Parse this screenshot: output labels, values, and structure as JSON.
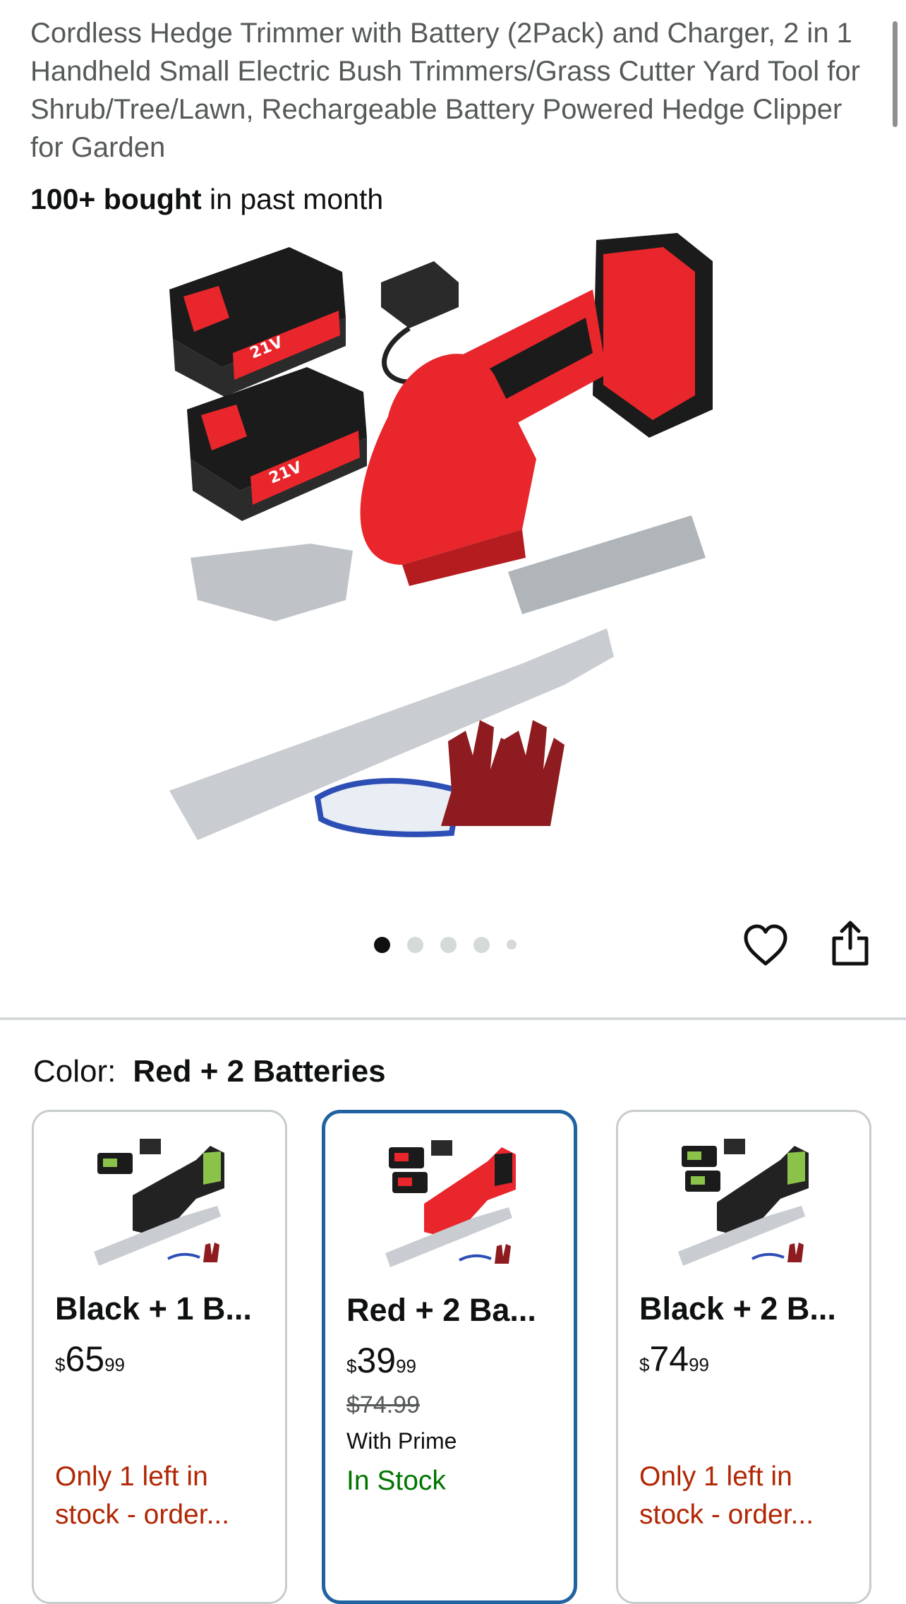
{
  "product": {
    "title": "Cordless Hedge Trimmer with Battery (2Pack) and Charger, 2 in 1 Handheld Small Electric Bush Trimmers/Grass Cutter Yard Tool for Shrub/Tree/Lawn, Rechargeable Battery Powered Hedge Clipper for Garden",
    "bought_bold": "100+ bought",
    "bought_rest": " in past month",
    "image_count": 5,
    "active_image": 1
  },
  "color": {
    "label": "Color:",
    "selected": "Red + 2 Batteries"
  },
  "variants": [
    {
      "name": "Black + 1 B...",
      "price_symbol": "$",
      "price_whole": "65",
      "price_fraction": "99",
      "strike": "",
      "prime": "",
      "stock": "Only 1 left in stock - order...",
      "stock_type": "low",
      "tool_color": "#222222",
      "accent": "#8bc34a"
    },
    {
      "name": "Red + 2 Ba...",
      "price_symbol": "$",
      "price_whole": "39",
      "price_fraction": "99",
      "strike": "$74.99",
      "prime": "With Prime",
      "stock": "In Stock",
      "stock_type": "in",
      "tool_color": "#e8262b",
      "accent": "#e8262b"
    },
    {
      "name": "Black + 2 B...",
      "price_symbol": "$",
      "price_whole": "74",
      "price_fraction": "99",
      "strike": "",
      "prime": "",
      "stock": "Only 1 left in stock - order...",
      "stock_type": "low",
      "tool_color": "#222222",
      "accent": "#8bc34a"
    }
  ],
  "icons": {
    "favorite": "heart-icon",
    "share": "share-icon"
  },
  "colors": {
    "selected_border": "#2162a1",
    "low_stock": "#b12704",
    "in_stock": "#007600"
  }
}
